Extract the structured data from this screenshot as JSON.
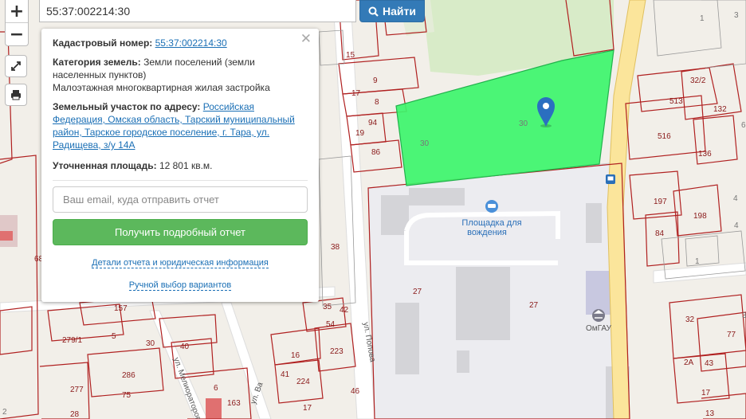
{
  "search": {
    "value": "55:37:002214:30",
    "button_label": "Найти"
  },
  "controls": {
    "zoom_in": "+",
    "zoom_out": "−",
    "fullscreen_icon": "expand-icon",
    "print_icon": "printer-icon"
  },
  "popup": {
    "cadastral_label": "Кадастровый номер:",
    "cadastral_value": "55:37:002214:30",
    "category_label": "Категория земель:",
    "category_value": "Земли поселений (земли населенных пунктов)",
    "usage_value": "Малоэтажная многоквартирная жилая застройка",
    "address_label": "Земельный участок по адресу:",
    "address_value": "Российская Федерация, Омская область, Тарский муниципальный район, Тарское городское поселение, г. Тара, ул. Радищева, з/у 14А",
    "area_label": "Уточненная площадь:",
    "area_value": "12 801 кв.м.",
    "email_placeholder": "Ваш email, куда отправить отчет",
    "report_button": "Получить подробный отчет",
    "details_link": "Детали отчета и юридическая информация",
    "manual_link": "Ручной выбор вариантов",
    "close": "✕"
  },
  "map": {
    "highlight_color": "#3df56b",
    "plot_border_color": "#b02020",
    "parcel_labels": [
      "30",
      "30",
      "15",
      "9",
      "8",
      "17",
      "19",
      "94",
      "86",
      "513",
      "32/2",
      "132",
      "516",
      "136",
      "197",
      "198",
      "84",
      "157",
      "5",
      "286",
      "75",
      "277",
      "279/1",
      "68",
      "38",
      "35",
      "42",
      "54",
      "223",
      "30",
      "40",
      "16",
      "41",
      "224",
      "46",
      "17",
      "6",
      "163",
      "28",
      "2",
      "27",
      "27",
      "32",
      "77",
      "2А",
      "43",
      "17",
      "13",
      "1",
      "3",
      "6",
      "4",
      "4",
      "1",
      "3"
    ],
    "street_labels": [
      "ул. Попова",
      "ул. Мелиораторов",
      "ул. Ва"
    ],
    "poi": [
      {
        "name": "Площадка для вождения",
        "icon": "car-icon"
      },
      {
        "name": "ОмГАУ",
        "icon": "university-icon"
      }
    ],
    "marker_icon": "map-pin-icon",
    "bus_stop_icon": "bus-stop-icon"
  }
}
